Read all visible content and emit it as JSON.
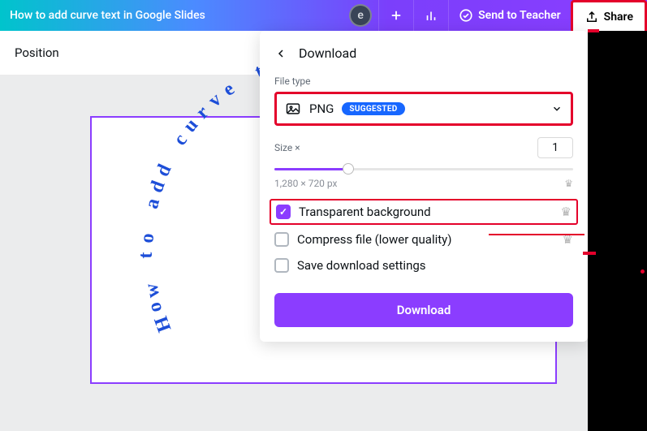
{
  "header": {
    "title": "How to add curve text in Google Slides",
    "avatar_initial": "e",
    "send_label": "Send to Teacher",
    "share_label": "Share"
  },
  "subbar": {
    "position_label": "Position"
  },
  "slide": {
    "curve_text": "How to add curve text"
  },
  "panel": {
    "title": "Download",
    "file_type_label": "File type",
    "file_type_value": "PNG",
    "file_type_badge": "SUGGESTED",
    "size_label": "Size ×",
    "size_value": "1",
    "dimensions": "1,280 × 720 px",
    "opt_transparent": "Transparent background",
    "opt_compress": "Compress file (lower quality)",
    "opt_save_settings": "Save download settings",
    "download_label": "Download"
  }
}
